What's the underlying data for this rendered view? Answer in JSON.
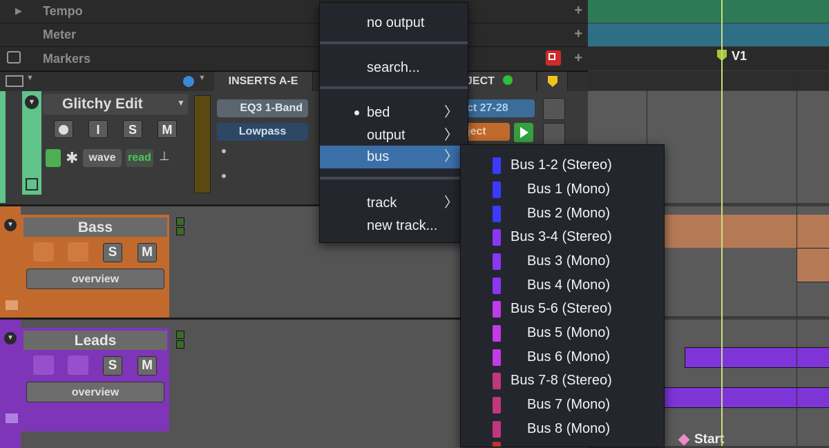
{
  "rulers": {
    "tempo_label": "Tempo",
    "meter_label": "Meter",
    "markers_label": "Markers",
    "marker_v1": "V1",
    "marker_start": "Start"
  },
  "header": {
    "inserts_label": "INSERTS A-E",
    "object_label": "JECT"
  },
  "tracks": [
    {
      "name": "Glitchy Edit",
      "buttons": [
        "I",
        "S",
        "M"
      ],
      "view_label": "wave",
      "automation_label": "read",
      "inserts": [
        "EQ3 1-Band",
        "Lowpass"
      ],
      "output_label": "ct 27-28",
      "object_label": "ject",
      "color": "#5fc38a"
    },
    {
      "name": "Bass",
      "buttons": [
        "S",
        "M"
      ],
      "view_label": "overview",
      "color": "#c26a2e"
    },
    {
      "name": "Leads",
      "buttons": [
        "S",
        "M"
      ],
      "view_label": "overview",
      "color": "#7e35b8"
    }
  ],
  "output_menu": {
    "items": [
      {
        "label": "no output",
        "submenu": false,
        "selected": false,
        "highlighted": false
      },
      {
        "label": "search...",
        "submenu": false,
        "selected": false,
        "highlighted": false
      },
      {
        "label": "bed",
        "submenu": true,
        "selected": true,
        "highlighted": false
      },
      {
        "label": "output",
        "submenu": true,
        "selected": false,
        "highlighted": false
      },
      {
        "label": "bus",
        "submenu": true,
        "selected": false,
        "highlighted": true
      },
      {
        "label": "track",
        "submenu": true,
        "selected": false,
        "highlighted": false
      },
      {
        "label": "new track...",
        "submenu": false,
        "selected": false,
        "highlighted": false
      }
    ],
    "highlight_color": "#3a6fa8"
  },
  "bus_menu": {
    "items": [
      {
        "label": "Bus 1-2 (Stereo)",
        "color": "#3b3bff",
        "indent": false
      },
      {
        "label": "Bus 1 (Mono)",
        "color": "#3b3bff",
        "indent": true
      },
      {
        "label": "Bus 2 (Mono)",
        "color": "#3b3bff",
        "indent": true
      },
      {
        "label": "Bus 3-4 (Stereo)",
        "color": "#8a36f2",
        "indent": false
      },
      {
        "label": "Bus 3 (Mono)",
        "color": "#8a36f2",
        "indent": true
      },
      {
        "label": "Bus 4 (Mono)",
        "color": "#8a36f2",
        "indent": true
      },
      {
        "label": "Bus 5-6 (Stereo)",
        "color": "#c13be8",
        "indent": false
      },
      {
        "label": "Bus 5 (Mono)",
        "color": "#c13be8",
        "indent": true
      },
      {
        "label": "Bus 6 (Mono)",
        "color": "#c13be8",
        "indent": true
      },
      {
        "label": "Bus 7-8 (Stereo)",
        "color": "#c2367e",
        "indent": false
      },
      {
        "label": "Bus 7 (Mono)",
        "color": "#c2367e",
        "indent": true
      },
      {
        "label": "Bus 8 (Mono)",
        "color": "#c2367e",
        "indent": true
      }
    ]
  }
}
